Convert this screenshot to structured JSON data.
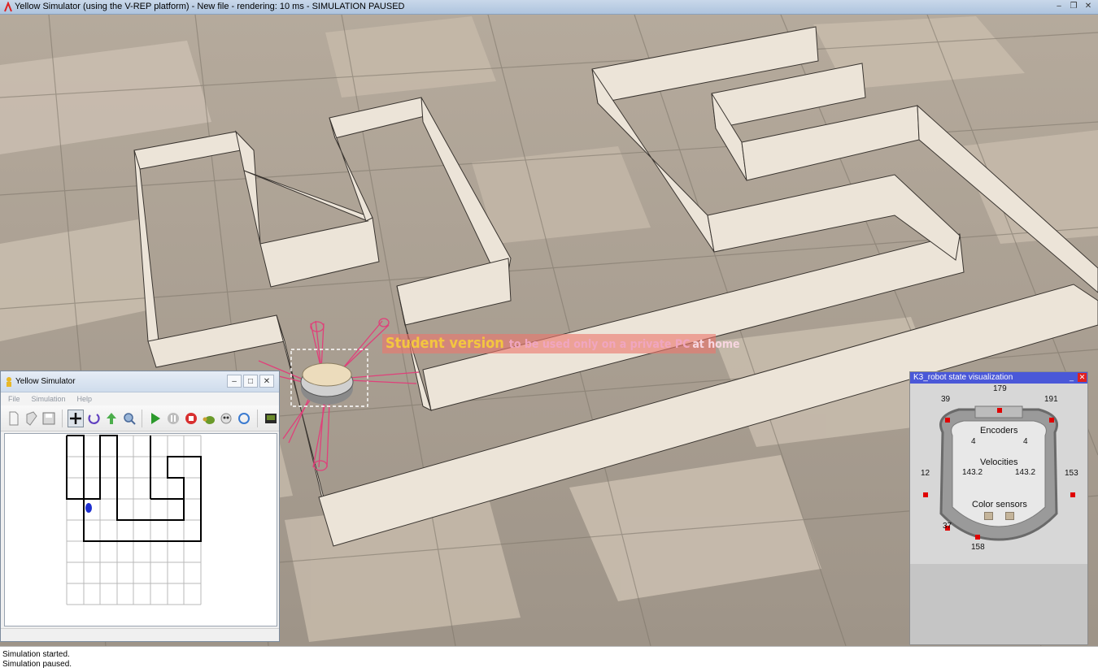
{
  "window": {
    "title": "Yellow Simulator (using the V-REP platform) - New file - rendering: 10 ms - SIMULATION PAUSED",
    "controls": [
      "minimize",
      "restore",
      "close"
    ]
  },
  "watermark": {
    "part1": "Student version",
    "part2": "to be used only on a private PC",
    "part3": "at home"
  },
  "yellow_sim": {
    "title": "Yellow Simulator",
    "menu": [
      "File",
      "Simulation",
      "Help"
    ],
    "toolbar_icons": [
      "new-file-icon",
      "open-file-icon",
      "save-icon",
      "move-icon",
      "rotate-icon",
      "up-icon",
      "zoom-icon",
      "play-icon",
      "pause-icon",
      "stop-icon",
      "slow-icon",
      "fast-icon",
      "reset-icon",
      "terminal-icon"
    ],
    "colors": {
      "walls": "#000000",
      "grid": "#b9b9b9",
      "robot": "#1e2fd0"
    }
  },
  "k3": {
    "title": "K3_robot state visualization",
    "sensors": {
      "top": "179",
      "top_left": "39",
      "top_right": "191",
      "left": "12",
      "right": "153",
      "bottom_left": "37",
      "bottom": "158"
    },
    "encoders_label": "Encoders",
    "encoder_left": "4",
    "encoder_right": "4",
    "velocities_label": "Velocities",
    "velocity_left": "143.2",
    "velocity_right": "143.2",
    "color_sensors_label": "Color sensors"
  },
  "status": {
    "line1": "Simulation started.",
    "line2": "Simulation paused."
  }
}
